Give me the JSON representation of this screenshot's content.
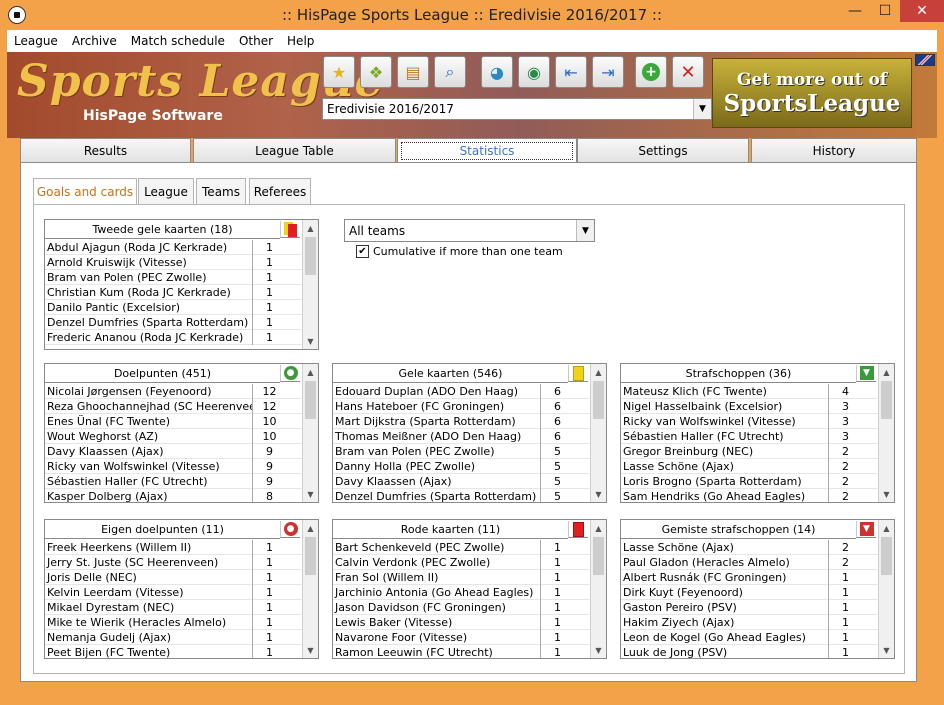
{
  "window": {
    "title": ":: HisPage Sports League :: Eredivisie 2016/2017 ::",
    "min": "—",
    "max": "☐",
    "close": "✕"
  },
  "menu": [
    "League",
    "Archive",
    "Match schedule",
    "Other",
    "Help"
  ],
  "banner": {
    "logo": "Sports League",
    "sub": "HisPage Software",
    "league_select": "Eredivisie 2016/2017",
    "ad_line1": "Get more out of",
    "ad_line2": "SportsLeague"
  },
  "toolbar": [
    "star-icon",
    "box-icon",
    "archive-icon",
    "search-icon",
    "folder-globe-icon",
    "globe-icon",
    "import-icon",
    "export-icon",
    "add-icon",
    "delete-icon"
  ],
  "main_tabs": [
    "Results",
    "League Table",
    "Statistics",
    "Settings",
    "History"
  ],
  "sub_tabs": [
    "Goals and cards",
    "League",
    "Teams",
    "Referees"
  ],
  "filter": {
    "team": "All teams",
    "cumulative_label": "Cumulative if more than one team"
  },
  "tables": {
    "second_yellow": {
      "title": "Tweede gele kaarten (18)",
      "rows": [
        [
          "Abdul Ajagun (Roda JC Kerkrade)",
          "1"
        ],
        [
          "Arnold Kruiswijk (Vitesse)",
          "1"
        ],
        [
          "Bram van Polen (PEC Zwolle)",
          "1"
        ],
        [
          "Christian Kum (Roda JC Kerkrade)",
          "1"
        ],
        [
          "Danilo Pantic (Excelsior)",
          "1"
        ],
        [
          "Denzel Dumfries (Sparta Rotterdam)",
          "1"
        ],
        [
          "Frederic Ananou (Roda JC Kerkrade)",
          "1"
        ]
      ]
    },
    "goals": {
      "title": "Doelpunten (451)",
      "rows": [
        [
          "Nicolai Jørgensen (Feyenoord)",
          "12"
        ],
        [
          "Reza Ghoochannejhad (SC Heerenveen)",
          "12"
        ],
        [
          "Enes Ünal (FC Twente)",
          "10"
        ],
        [
          "Wout Weghorst (AZ)",
          "10"
        ],
        [
          "Davy Klaassen (Ajax)",
          "9"
        ],
        [
          "Ricky van Wolfswinkel (Vitesse)",
          "9"
        ],
        [
          "Sébastien Haller (FC Utrecht)",
          "9"
        ],
        [
          "Kasper Dolberg (Ajax)",
          "8"
        ]
      ]
    },
    "yellow": {
      "title": "Gele kaarten (546)",
      "rows": [
        [
          "Edouard Duplan (ADO Den Haag)",
          "6"
        ],
        [
          "Hans Hateboer (FC Groningen)",
          "6"
        ],
        [
          "Mart Dijkstra (Sparta Rotterdam)",
          "6"
        ],
        [
          "Thomas Meißner (ADO Den Haag)",
          "6"
        ],
        [
          "Bram van Polen (PEC Zwolle)",
          "5"
        ],
        [
          "Danny Holla (PEC Zwolle)",
          "5"
        ],
        [
          "Davy Klaassen (Ajax)",
          "5"
        ],
        [
          "Denzel Dumfries (Sparta Rotterdam)",
          "5"
        ]
      ]
    },
    "penalties": {
      "title": "Strafschoppen (36)",
      "rows": [
        [
          "Mateusz Klich (FC Twente)",
          "4"
        ],
        [
          "Nigel Hasselbaink (Excelsior)",
          "3"
        ],
        [
          "Ricky van Wolfswinkel (Vitesse)",
          "3"
        ],
        [
          "Sébastien Haller (FC Utrecht)",
          "3"
        ],
        [
          "Gregor Breinburg (NEC)",
          "2"
        ],
        [
          "Lasse Schöne (Ajax)",
          "2"
        ],
        [
          "Loris Brogno (Sparta Rotterdam)",
          "2"
        ],
        [
          "Sam Hendriks (Go Ahead Eagles)",
          "2"
        ]
      ]
    },
    "own_goals": {
      "title": "Eigen doelpunten (11)",
      "rows": [
        [
          "Freek Heerkens (Willem II)",
          "1"
        ],
        [
          "Jerry St. Juste (SC Heerenveen)",
          "1"
        ],
        [
          "Joris Delle (NEC)",
          "1"
        ],
        [
          "Kelvin Leerdam (Vitesse)",
          "1"
        ],
        [
          "Mikael Dyrestam (NEC)",
          "1"
        ],
        [
          "Mike te Wierik (Heracles Almelo)",
          "1"
        ],
        [
          "Nemanja Gudelj (Ajax)",
          "1"
        ],
        [
          "Peet Bijen (FC Twente)",
          "1"
        ]
      ]
    },
    "red": {
      "title": "Rode kaarten (11)",
      "rows": [
        [
          "Bart Schenkeveld (PEC Zwolle)",
          "1"
        ],
        [
          "Calvin Verdonk (PEC Zwolle)",
          "1"
        ],
        [
          "Fran Sol (Willem II)",
          "1"
        ],
        [
          "Jarchinio Antonia (Go Ahead Eagles)",
          "1"
        ],
        [
          "Jason Davidson (FC Groningen)",
          "1"
        ],
        [
          "Lewis Baker (Vitesse)",
          "1"
        ],
        [
          "Navarone Foor (Vitesse)",
          "1"
        ],
        [
          "Ramon Leeuwin (FC Utrecht)",
          "1"
        ]
      ]
    },
    "missed_penalties": {
      "title": "Gemiste strafschoppen (14)",
      "rows": [
        [
          "Lasse Schöne (Ajax)",
          "2"
        ],
        [
          "Paul Gladon (Heracles Almelo)",
          "2"
        ],
        [
          "Albert Rusnák (FC Groningen)",
          "1"
        ],
        [
          "Dirk Kuyt (Feyenoord)",
          "1"
        ],
        [
          "Gaston Pereiro (PSV)",
          "1"
        ],
        [
          "Hakim Ziyech (Ajax)",
          "1"
        ],
        [
          "Leon de Kogel (Go Ahead Eagles)",
          "1"
        ],
        [
          "Luuk de Jong (PSV)",
          "1"
        ]
      ]
    }
  }
}
